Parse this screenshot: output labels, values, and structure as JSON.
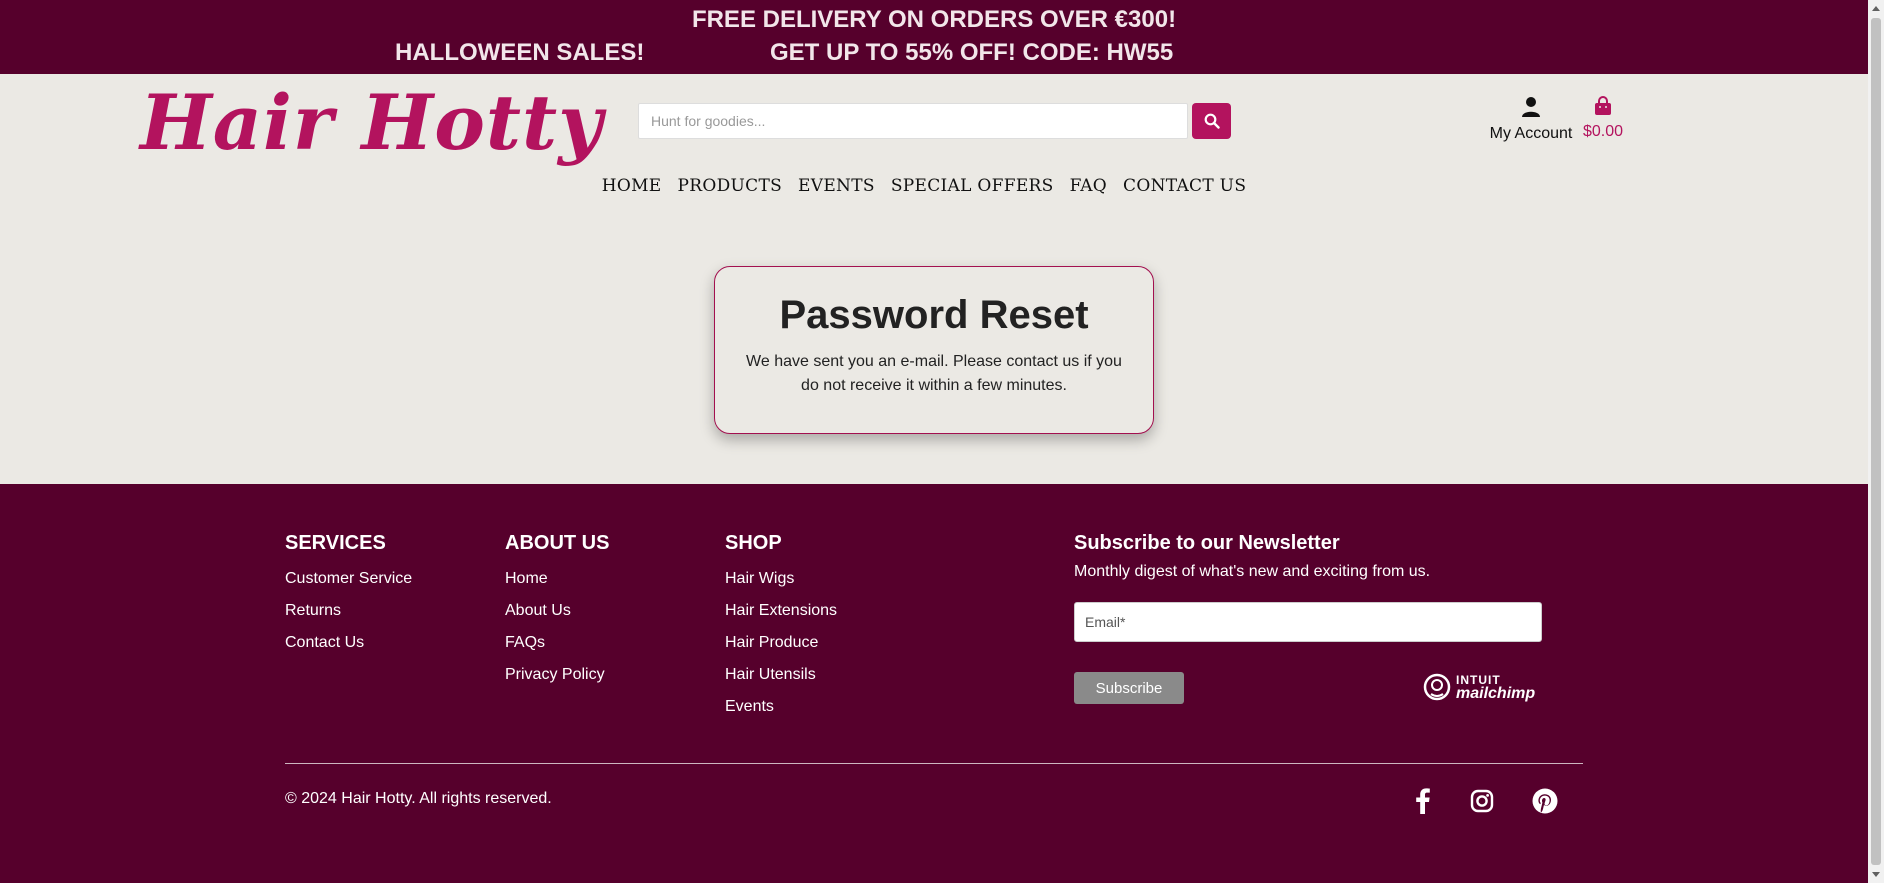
{
  "banner": {
    "line1": "FREE DELIVERY ON ORDERS OVER €300!",
    "line2_left": "HALLOWEEN SALES!",
    "line2_right": "GET UP TO 55% OFF! CODE: HW55"
  },
  "header": {
    "logo": "Hair Hotty",
    "search_placeholder": "Hunt for goodies...",
    "search_icon": "search-icon",
    "account_label": "My Account",
    "account_icon": "user-icon",
    "cart_total": "$0.00",
    "cart_icon": "shopping-bag-icon"
  },
  "nav": [
    "HOME",
    "PRODUCTS",
    "EVENTS",
    "SPECIAL OFFERS",
    "FAQ",
    "CONTACT US"
  ],
  "card": {
    "title": "Password Reset",
    "message": "We have sent you an e-mail. Please contact us if you do not receive it within a few minutes."
  },
  "footer": {
    "services": {
      "heading": "SERVICES",
      "links": [
        "Customer Service",
        "Returns",
        "Contact Us"
      ]
    },
    "about": {
      "heading": "ABOUT US",
      "links": [
        "Home",
        "About Us",
        "FAQs",
        "Privacy Policy"
      ]
    },
    "shop": {
      "heading": "SHOP",
      "links": [
        "Hair Wigs",
        "Hair Extensions",
        "Hair Produce",
        "Hair Utensils",
        "Events"
      ]
    },
    "newsletter": {
      "heading": "Subscribe to our Newsletter",
      "digest": "Monthly digest of what's new and exciting from us.",
      "email_placeholder": "Email*",
      "subscribe_label": "Subscribe",
      "mailchimp_line1": "INTUIT",
      "mailchimp_line2": "mailchimp"
    },
    "copyright": "© 2024 Hair Hotty. All rights reserved.",
    "social": [
      "facebook-icon",
      "instagram-icon",
      "pinterest-icon"
    ]
  },
  "colors": {
    "brand_dark": "#56002c",
    "brand_accent": "#b3135e",
    "page_bg": "#ebe9e4"
  }
}
